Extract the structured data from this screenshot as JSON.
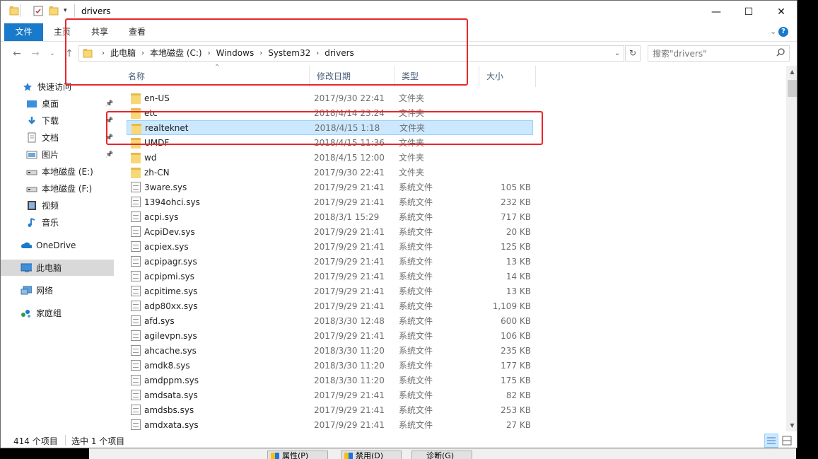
{
  "window": {
    "title": "drivers",
    "controls": {
      "minimize": "—",
      "maximize": "☐",
      "close": "✕"
    }
  },
  "ribbon": {
    "tabs": [
      "文件",
      "主页",
      "共享",
      "查看"
    ],
    "expand_glyph": "⌄",
    "help_glyph": "?"
  },
  "address": {
    "breadcrumbs": [
      "此电脑",
      "本地磁盘 (C:)",
      "Windows",
      "System32",
      "drivers"
    ],
    "separator": "›"
  },
  "search": {
    "placeholder": "搜索\"drivers\""
  },
  "nav": {
    "items": [
      {
        "label": "快速访问",
        "icon": "star-icon",
        "pinned": false
      },
      {
        "label": "桌面",
        "icon": "desktop-icon",
        "pinned": true
      },
      {
        "label": "下载",
        "icon": "download-icon",
        "pinned": true
      },
      {
        "label": "文档",
        "icon": "document-icon",
        "pinned": true
      },
      {
        "label": "图片",
        "icon": "picture-icon",
        "pinned": true
      },
      {
        "label": "本地磁盘 (E:)",
        "icon": "drive-icon",
        "pinned": false
      },
      {
        "label": "本地磁盘 (F:)",
        "icon": "drive-icon",
        "pinned": false
      },
      {
        "label": "视频",
        "icon": "video-icon",
        "pinned": false
      },
      {
        "label": "音乐",
        "icon": "music-icon",
        "pinned": false
      },
      {
        "label": "OneDrive",
        "icon": "cloud-icon",
        "pinned": false
      },
      {
        "label": "此电脑",
        "icon": "computer-icon",
        "pinned": false,
        "selected": true
      },
      {
        "label": "网络",
        "icon": "network-icon",
        "pinned": false
      },
      {
        "label": "家庭组",
        "icon": "homegroup-icon",
        "pinned": false
      }
    ]
  },
  "columns": {
    "name": "名称",
    "date": "修改日期",
    "type": "类型",
    "size": "大小"
  },
  "files": [
    {
      "name": "en-US",
      "date": "2017/9/30 22:41",
      "type": "文件夹",
      "size": "",
      "kind": "folder"
    },
    {
      "name": "etc",
      "date": "2018/4/14 23:24",
      "type": "文件夹",
      "size": "",
      "kind": "folder"
    },
    {
      "name": "realteknet",
      "date": "2018/4/15 1:18",
      "type": "文件夹",
      "size": "",
      "kind": "folder",
      "selected": true
    },
    {
      "name": "UMDF",
      "date": "2018/4/15 11:36",
      "type": "文件夹",
      "size": "",
      "kind": "folder"
    },
    {
      "name": "wd",
      "date": "2018/4/15 12:00",
      "type": "文件夹",
      "size": "",
      "kind": "folder"
    },
    {
      "name": "zh-CN",
      "date": "2017/9/30 22:41",
      "type": "文件夹",
      "size": "",
      "kind": "folder"
    },
    {
      "name": "3ware.sys",
      "date": "2017/9/29 21:41",
      "type": "系统文件",
      "size": "105 KB",
      "kind": "sys"
    },
    {
      "name": "1394ohci.sys",
      "date": "2017/9/29 21:41",
      "type": "系统文件",
      "size": "232 KB",
      "kind": "sys"
    },
    {
      "name": "acpi.sys",
      "date": "2018/3/1 15:29",
      "type": "系统文件",
      "size": "717 KB",
      "kind": "sys"
    },
    {
      "name": "AcpiDev.sys",
      "date": "2017/9/29 21:41",
      "type": "系统文件",
      "size": "20 KB",
      "kind": "sys"
    },
    {
      "name": "acpiex.sys",
      "date": "2017/9/29 21:41",
      "type": "系统文件",
      "size": "125 KB",
      "kind": "sys"
    },
    {
      "name": "acpipagr.sys",
      "date": "2017/9/29 21:41",
      "type": "系统文件",
      "size": "13 KB",
      "kind": "sys"
    },
    {
      "name": "acpipmi.sys",
      "date": "2017/9/29 21:41",
      "type": "系统文件",
      "size": "14 KB",
      "kind": "sys"
    },
    {
      "name": "acpitime.sys",
      "date": "2017/9/29 21:41",
      "type": "系统文件",
      "size": "13 KB",
      "kind": "sys"
    },
    {
      "name": "adp80xx.sys",
      "date": "2017/9/29 21:41",
      "type": "系统文件",
      "size": "1,109 KB",
      "kind": "sys"
    },
    {
      "name": "afd.sys",
      "date": "2018/3/30 12:48",
      "type": "系统文件",
      "size": "600 KB",
      "kind": "sys"
    },
    {
      "name": "agilevpn.sys",
      "date": "2017/9/29 21:41",
      "type": "系统文件",
      "size": "106 KB",
      "kind": "sys"
    },
    {
      "name": "ahcache.sys",
      "date": "2018/3/30 11:20",
      "type": "系统文件",
      "size": "235 KB",
      "kind": "sys"
    },
    {
      "name": "amdk8.sys",
      "date": "2018/3/30 11:20",
      "type": "系统文件",
      "size": "177 KB",
      "kind": "sys"
    },
    {
      "name": "amdppm.sys",
      "date": "2018/3/30 11:20",
      "type": "系统文件",
      "size": "175 KB",
      "kind": "sys"
    },
    {
      "name": "amdsata.sys",
      "date": "2017/9/29 21:41",
      "type": "系统文件",
      "size": "82 KB",
      "kind": "sys"
    },
    {
      "name": "amdsbs.sys",
      "date": "2017/9/29 21:41",
      "type": "系统文件",
      "size": "253 KB",
      "kind": "sys"
    },
    {
      "name": "amdxata.sys",
      "date": "2017/9/29 21:41",
      "type": "系统文件",
      "size": "27 KB",
      "kind": "sys"
    }
  ],
  "status": {
    "count": "414 个项目",
    "selection": "选中 1 个项目"
  },
  "underlying_buttons": [
    "属性(P)",
    "禁用(D)",
    "诊断(G)"
  ],
  "colors": {
    "accent": "#1979ca",
    "selection": "#cce8ff",
    "annotation": "#e8262b"
  }
}
